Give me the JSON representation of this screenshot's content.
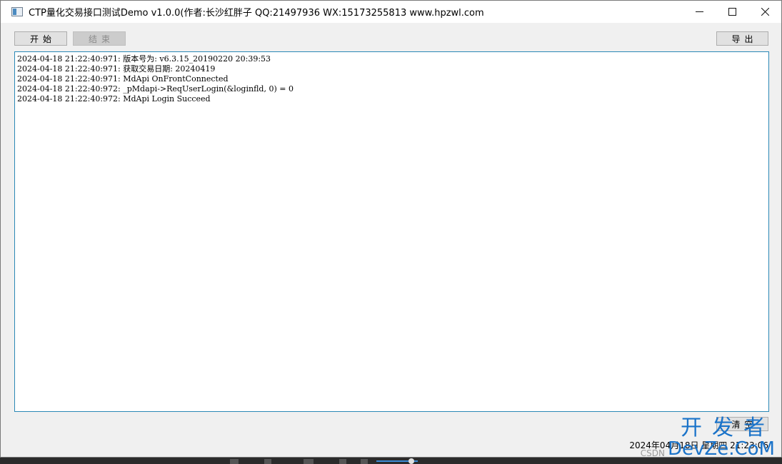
{
  "window": {
    "title": "CTP量化交易接口测试Demo v1.0.0(作者:长沙红胖子 QQ:21497936 WX:15173255813 www.hpzwl.com",
    "controls": {
      "minimize": "—",
      "maximize": "☐",
      "close": "✕"
    }
  },
  "toolbar": {
    "start_label": "开始",
    "stop_label": "结束",
    "export_label": "导出"
  },
  "log": {
    "lines": [
      "2024-04-18 21:22:40:971: 版本号为: v6.3.15_20190220 20:39:53",
      "2024-04-18 21:22:40:971: 获取交易日期: 20240419",
      "2024-04-18 21:22:40:971: MdApi OnFrontConnected",
      "2024-04-18 21:22:40:972: _pMdapi->ReqUserLogin(&loginfld, 0) = 0",
      "2024-04-18 21:22:40:972: MdApi Login Succeed"
    ]
  },
  "footer": {
    "clear_label": "清空",
    "status_text": "2024年04月18日 星期四 21:23:06"
  },
  "watermark": {
    "top": "开发者",
    "bottom_left": "CSDN",
    "bottom_right": "DevZe.CoM"
  },
  "colors": {
    "log_border": "#2b89b6",
    "watermark": "#1a73c9"
  }
}
